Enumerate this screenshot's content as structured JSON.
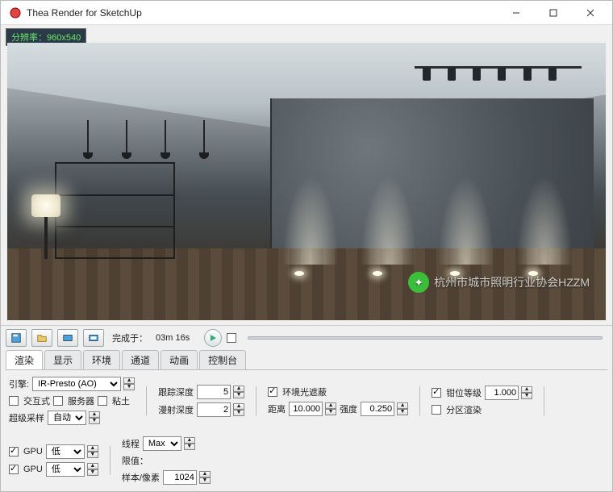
{
  "window": {
    "title": "Thea Render for SketchUp"
  },
  "resolution_bar": {
    "label": "分辨率：",
    "value": "960x540"
  },
  "status": {
    "done_label": "完成于：",
    "elapsed": "03m 16s"
  },
  "tabs": [
    "渲染",
    "显示",
    "环境",
    "通道",
    "动画",
    "控制台"
  ],
  "active_tab": 0,
  "engine": {
    "label": "引擎:",
    "value": "IR-Presto (AO)"
  },
  "checkrow": {
    "interactive": "交互式",
    "server": "服务器",
    "clay": "粘土"
  },
  "supersampling": {
    "label": "超级采样",
    "value": "自动"
  },
  "trace": {
    "tracing_depth_label": "跟踪深度",
    "tracing_depth": "5",
    "diffuse_depth_label": "漫射深度",
    "diffuse_depth": "2"
  },
  "ao": {
    "ao_label": "环境光遮蔽",
    "ao_checked": true,
    "distance_label": "距离",
    "distance": "10.000",
    "intensity_label": "强度",
    "intensity": "0.250"
  },
  "clamp": {
    "clamp_label": "钳位等级",
    "clamp_checked": true,
    "clamp_value": "1.000",
    "region_label": "分区渲染"
  },
  "gpu": {
    "gpu1_checked": true,
    "gpu1_label": "GPU",
    "gpu1_priority": "低",
    "gpu2_checked": true,
    "gpu2_label": "GPU",
    "gpu2_priority": "低"
  },
  "right": {
    "threads_label": "线程",
    "threads_value": "Max",
    "limit_label": "限值：",
    "samples_label": "样本/像素",
    "samples_value": "1024"
  },
  "watermark": "杭州市城市照明行业协会HZZM"
}
